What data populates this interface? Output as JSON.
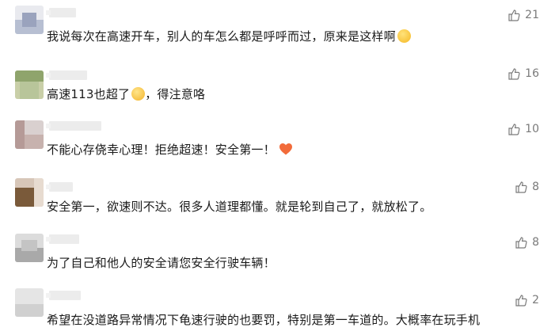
{
  "comments": [
    {
      "text": "我说每次在高速开车，别人的车怎么都是呼呼而过，原来是这样啊",
      "emoji": "thinking-face-emoji",
      "likes": "21"
    },
    {
      "text_before": "高速113也超了",
      "text_after": "，得注意咯",
      "emoji": "relieved-face-emoji",
      "likes": "16"
    },
    {
      "text": "不能心存侥幸心理！拒绝超速！安全第一！",
      "emoji": "heart-emoji",
      "likes": "10"
    },
    {
      "text": "安全第一，欲速则不达。很多人道理都懂。就是轮到自己了，就放松了。",
      "likes": "8"
    },
    {
      "text": "为了自己和他人的安全请您安全行驶车辆！",
      "likes": "8"
    },
    {
      "text": "希望在没道路异常情况下龟速行驶的也要罚，特别是第一车道的。大概率在玩手机",
      "likes": "2"
    }
  ],
  "colors": {
    "text": "#1a1a1a",
    "like": "#7a7a7a",
    "heart": "#f26b3a"
  }
}
